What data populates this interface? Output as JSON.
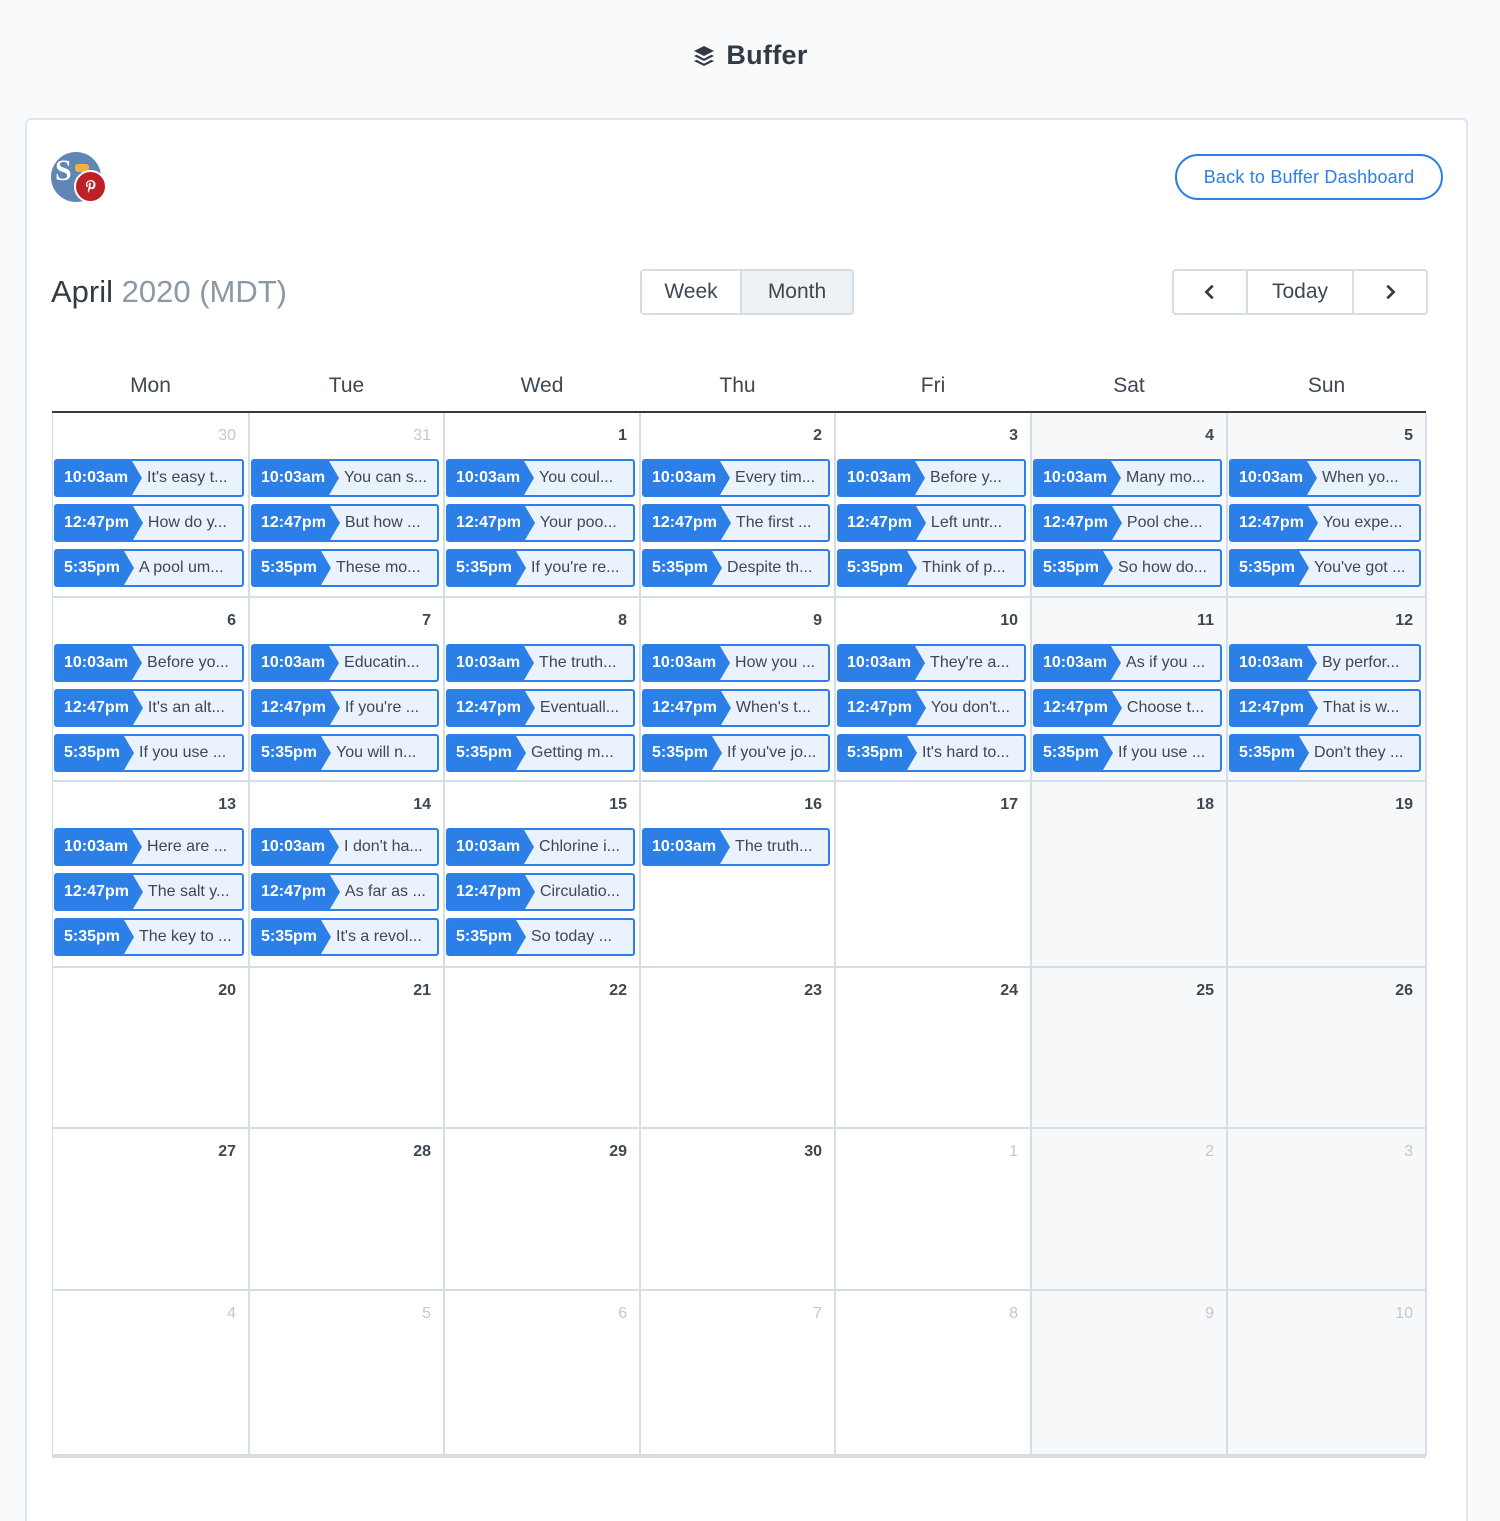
{
  "brand": {
    "name": "Buffer",
    "icon": "buffer-stack-icon"
  },
  "avatar": {
    "letter": "S",
    "badge_icon": "pinterest-icon"
  },
  "header": {
    "back_button": "Back to Buffer Dashboard"
  },
  "calendar": {
    "month": "April",
    "year_tz": "2020 (MDT)",
    "views": {
      "week": "Week",
      "month": "Month",
      "active": "Month"
    },
    "nav": {
      "prev_icon": "chevron-left-icon",
      "today": "Today",
      "next_icon": "chevron-right-icon"
    },
    "weekdays": [
      "Mon",
      "Tue",
      "Wed",
      "Thu",
      "Fri",
      "Sat",
      "Sun"
    ],
    "weeks": [
      [
        {
          "day": "30",
          "other": true,
          "posts": [
            {
              "time": "10:03am",
              "text": "It's easy t..."
            },
            {
              "time": "12:47pm",
              "text": "How do y..."
            },
            {
              "time": "5:35pm",
              "text": "A pool um..."
            }
          ]
        },
        {
          "day": "31",
          "other": true,
          "posts": [
            {
              "time": "10:03am",
              "text": "You can s..."
            },
            {
              "time": "12:47pm",
              "text": "But how ..."
            },
            {
              "time": "5:35pm",
              "text": "These mo..."
            }
          ]
        },
        {
          "day": "1",
          "other": false,
          "posts": [
            {
              "time": "10:03am",
              "text": "You coul..."
            },
            {
              "time": "12:47pm",
              "text": "Your poo..."
            },
            {
              "time": "5:35pm",
              "text": "If you're re..."
            }
          ]
        },
        {
          "day": "2",
          "other": false,
          "posts": [
            {
              "time": "10:03am",
              "text": "Every tim..."
            },
            {
              "time": "12:47pm",
              "text": "The first ..."
            },
            {
              "time": "5:35pm",
              "text": "Despite th..."
            }
          ]
        },
        {
          "day": "3",
          "other": false,
          "posts": [
            {
              "time": "10:03am",
              "text": "Before y..."
            },
            {
              "time": "12:47pm",
              "text": "Left untr..."
            },
            {
              "time": "5:35pm",
              "text": "Think of p..."
            }
          ]
        },
        {
          "day": "4",
          "other": false,
          "posts": [
            {
              "time": "10:03am",
              "text": "Many mo..."
            },
            {
              "time": "12:47pm",
              "text": "Pool che..."
            },
            {
              "time": "5:35pm",
              "text": "So how do..."
            }
          ]
        },
        {
          "day": "5",
          "other": false,
          "posts": [
            {
              "time": "10:03am",
              "text": "When yo..."
            },
            {
              "time": "12:47pm",
              "text": "You expe..."
            },
            {
              "time": "5:35pm",
              "text": "You've got ..."
            }
          ]
        }
      ],
      [
        {
          "day": "6",
          "other": false,
          "posts": [
            {
              "time": "10:03am",
              "text": "Before yo..."
            },
            {
              "time": "12:47pm",
              "text": "It's an alt..."
            },
            {
              "time": "5:35pm",
              "text": "If you use ..."
            }
          ]
        },
        {
          "day": "7",
          "other": false,
          "posts": [
            {
              "time": "10:03am",
              "text": "Educatin..."
            },
            {
              "time": "12:47pm",
              "text": "If you're ..."
            },
            {
              "time": "5:35pm",
              "text": "You will n..."
            }
          ]
        },
        {
          "day": "8",
          "other": false,
          "posts": [
            {
              "time": "10:03am",
              "text": "The truth..."
            },
            {
              "time": "12:47pm",
              "text": "Eventuall..."
            },
            {
              "time": "5:35pm",
              "text": "Getting m..."
            }
          ]
        },
        {
          "day": "9",
          "other": false,
          "posts": [
            {
              "time": "10:03am",
              "text": "How you ..."
            },
            {
              "time": "12:47pm",
              "text": "When's t..."
            },
            {
              "time": "5:35pm",
              "text": "If you've jo..."
            }
          ]
        },
        {
          "day": "10",
          "other": false,
          "posts": [
            {
              "time": "10:03am",
              "text": "They're a..."
            },
            {
              "time": "12:47pm",
              "text": "You don't..."
            },
            {
              "time": "5:35pm",
              "text": "It's hard to..."
            }
          ]
        },
        {
          "day": "11",
          "other": false,
          "posts": [
            {
              "time": "10:03am",
              "text": "As if you ..."
            },
            {
              "time": "12:47pm",
              "text": "Choose t..."
            },
            {
              "time": "5:35pm",
              "text": "If you use ..."
            }
          ]
        },
        {
          "day": "12",
          "other": false,
          "posts": [
            {
              "time": "10:03am",
              "text": "By perfor..."
            },
            {
              "time": "12:47pm",
              "text": "That is w..."
            },
            {
              "time": "5:35pm",
              "text": "Don't they ..."
            }
          ]
        }
      ],
      [
        {
          "day": "13",
          "other": false,
          "posts": [
            {
              "time": "10:03am",
              "text": "Here are ..."
            },
            {
              "time": "12:47pm",
              "text": "The salt y..."
            },
            {
              "time": "5:35pm",
              "text": "The key to ..."
            }
          ]
        },
        {
          "day": "14",
          "other": false,
          "posts": [
            {
              "time": "10:03am",
              "text": "I don't ha..."
            },
            {
              "time": "12:47pm",
              "text": "As far as ..."
            },
            {
              "time": "5:35pm",
              "text": "It's a revol..."
            }
          ]
        },
        {
          "day": "15",
          "other": false,
          "posts": [
            {
              "time": "10:03am",
              "text": "Chlorine i..."
            },
            {
              "time": "12:47pm",
              "text": "Circulatio..."
            },
            {
              "time": "5:35pm",
              "text": "So today ..."
            }
          ]
        },
        {
          "day": "16",
          "other": false,
          "posts": [
            {
              "time": "10:03am",
              "text": "The truth..."
            }
          ]
        },
        {
          "day": "17",
          "other": false,
          "posts": []
        },
        {
          "day": "18",
          "other": false,
          "posts": []
        },
        {
          "day": "19",
          "other": false,
          "posts": []
        }
      ],
      [
        {
          "day": "20",
          "other": false,
          "posts": []
        },
        {
          "day": "21",
          "other": false,
          "posts": []
        },
        {
          "day": "22",
          "other": false,
          "posts": []
        },
        {
          "day": "23",
          "other": false,
          "posts": []
        },
        {
          "day": "24",
          "other": false,
          "posts": []
        },
        {
          "day": "25",
          "other": false,
          "posts": []
        },
        {
          "day": "26",
          "other": false,
          "posts": []
        }
      ],
      [
        {
          "day": "27",
          "other": false,
          "posts": []
        },
        {
          "day": "28",
          "other": false,
          "posts": []
        },
        {
          "day": "29",
          "other": false,
          "posts": []
        },
        {
          "day": "30",
          "other": false,
          "posts": []
        },
        {
          "day": "1",
          "other": true,
          "posts": []
        },
        {
          "day": "2",
          "other": true,
          "posts": []
        },
        {
          "day": "3",
          "other": true,
          "posts": []
        }
      ],
      [
        {
          "day": "4",
          "other": true,
          "posts": []
        },
        {
          "day": "5",
          "other": true,
          "posts": []
        },
        {
          "day": "6",
          "other": true,
          "posts": []
        },
        {
          "day": "7",
          "other": true,
          "posts": []
        },
        {
          "day": "8",
          "other": true,
          "posts": []
        },
        {
          "day": "9",
          "other": true,
          "posts": []
        },
        {
          "day": "10",
          "other": true,
          "posts": []
        }
      ]
    ]
  },
  "colors": {
    "accent": "#2c7fe6",
    "post_bg": "#eaf2fd",
    "pinterest": "#bd2125"
  }
}
